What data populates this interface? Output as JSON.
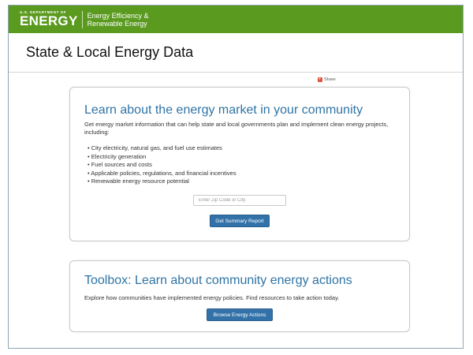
{
  "header": {
    "agency_small": "U.S. DEPARTMENT OF",
    "agency_big": "ENERGY",
    "office_line1": "Energy Efficiency &",
    "office_line2": "Renewable Energy"
  },
  "page": {
    "title": "State & Local Energy Data",
    "share_label": "Share"
  },
  "market_card": {
    "heading": "Learn about the energy market in your community",
    "description": "Get energy market information that can help state and local governments plan and implement clean energy projects, including:",
    "bullets": [
      "City electricity, natural gas, and fuel use estimates",
      "Electricity generation",
      "Fuel sources and costs",
      "Applicable policies, regulations, and financial incentives",
      "Renewable energy resource potential"
    ],
    "zip_placeholder": "Enter Zip Code or City",
    "zip_value": "",
    "button_label": "Get Summary Report"
  },
  "toolbox_card": {
    "heading": "Toolbox: Learn about community energy actions",
    "description": "Explore how communities have implemented energy policies. Find resources to take action today.",
    "button_label": "Browse Energy Actions"
  },
  "colors": {
    "header_green": "#5a9a1f",
    "heading_blue": "#2f74a5",
    "button_blue": "#3372a8",
    "share_red": "#d9533a"
  }
}
